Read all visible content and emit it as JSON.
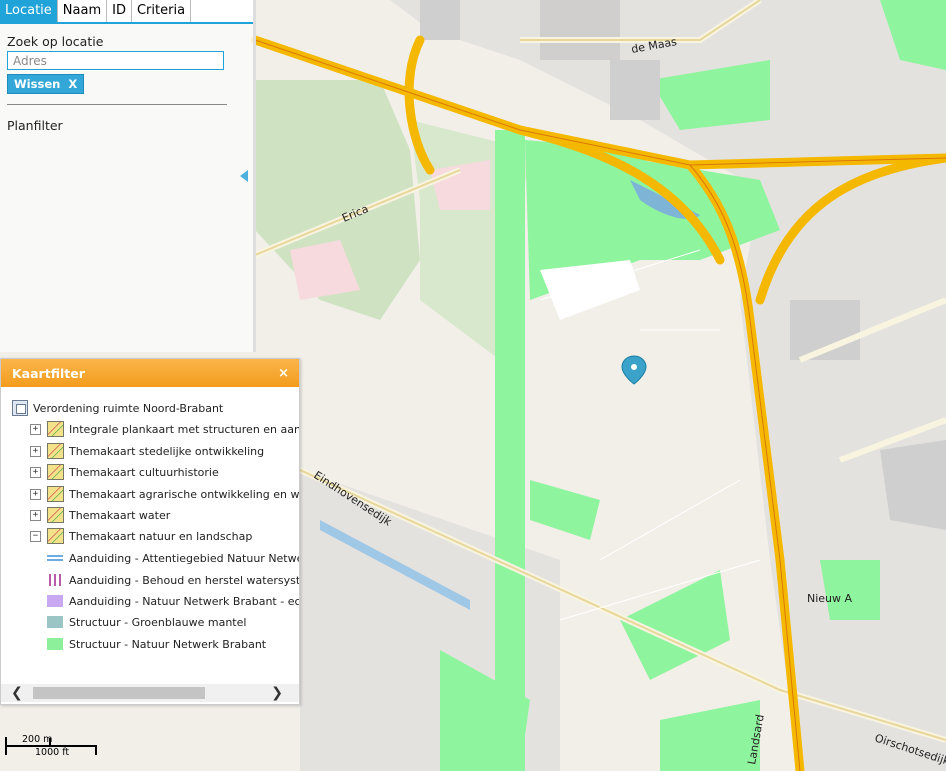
{
  "tabs": [
    {
      "label": "Locatie",
      "active": true
    },
    {
      "label": "Naam",
      "active": false
    },
    {
      "label": "ID",
      "active": false
    },
    {
      "label": "Criteria",
      "active": false
    }
  ],
  "search": {
    "label": "Zoek op locatie",
    "placeholder": "Adres",
    "value": "",
    "clear_label": "Wissen",
    "clear_icon": "X"
  },
  "planfilter_label": "Planfilter",
  "kaartfilter": {
    "title": "Kaartfilter",
    "close_icon": "×",
    "root_label": "Verordening ruimte Noord-Brabant",
    "layers": [
      {
        "expander": "+",
        "label": "Integrale plankaart met structuren en aanduidi"
      },
      {
        "expander": "+",
        "label": "Themakaart stedelijke ontwikkeling"
      },
      {
        "expander": "+",
        "label": "Themakaart cultuurhistorie"
      },
      {
        "expander": "+",
        "label": "Themakaart agrarische ontwikkeling en windtu"
      },
      {
        "expander": "+",
        "label": "Themakaart water"
      },
      {
        "expander": "−",
        "label": "Themakaart natuur en landschap"
      }
    ],
    "legend": [
      {
        "label": "Aanduiding - Attentiegebied Natuur Netwerk B",
        "swatch": "double-line",
        "color": "#3c8fd8"
      },
      {
        "label": "Aanduiding - Behoud en herstel watersystemen",
        "swatch": "vertical-hatch",
        "color": "#a0268c"
      },
      {
        "label": "Aanduiding - Natuur Netwerk Brabant - ecologi",
        "swatch": "fill",
        "color": "#c9a8f2"
      },
      {
        "label": "Structuur - Groenblauwe mantel",
        "swatch": "fill",
        "color": "#9bc5c5"
      },
      {
        "label": "Structuur - Natuur Netwerk Brabant",
        "swatch": "fill",
        "color": "#8cf09a"
      }
    ],
    "scroll_left_icon": "❮",
    "scroll_right_icon": "❯"
  },
  "map": {
    "street_labels": [
      "de Maas",
      "Erica",
      "Eindhovensedijk",
      "Nieuw A",
      "Oirschotsedijk",
      "Landsard"
    ],
    "colors": {
      "motorway": "#f5b800",
      "nature": "#8ff49e",
      "land": "#f2efe9",
      "residential": "#e0dfdf"
    },
    "marker_icon": "location-pin-icon"
  },
  "scale": {
    "metric": "200 m",
    "imperial": "1000 ft"
  }
}
